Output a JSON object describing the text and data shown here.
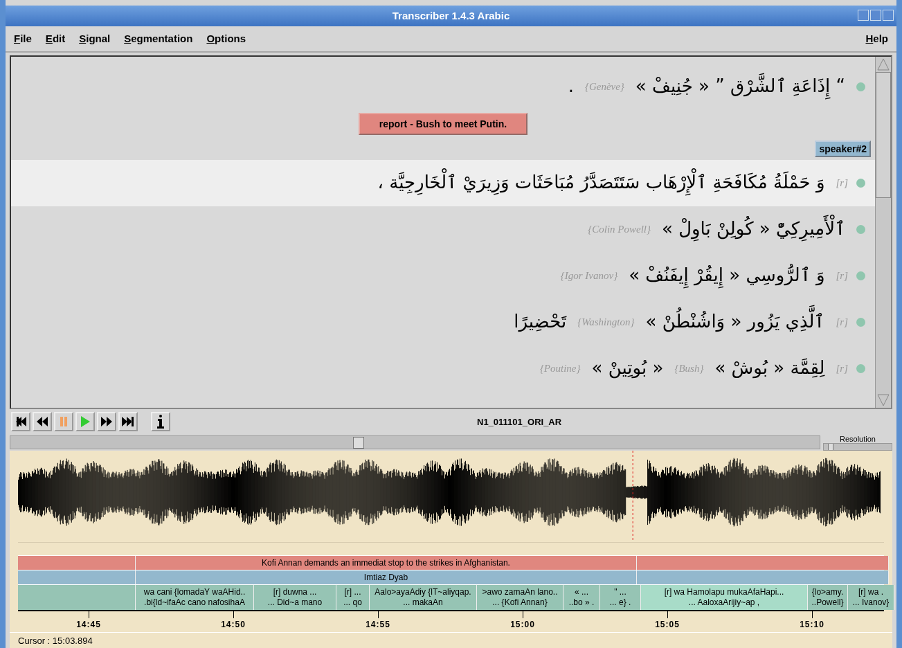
{
  "window": {
    "title": "Transcriber 1.4.3 Arabic"
  },
  "menu": [
    {
      "label": "File"
    },
    {
      "label": "Edit"
    },
    {
      "label": "Signal"
    },
    {
      "label": "Segmentation"
    },
    {
      "label": "Options"
    }
  ],
  "help_menu": "Help",
  "transcript": [
    {
      "kind": "line",
      "selected": false,
      "parts": [
        {
          "kind": "ar",
          "text": "."
        },
        {
          "kind": "note",
          "text": "{Genève}"
        },
        {
          "kind": "ar",
          "text": "“ إِذَاعَةِ ٱلشَّرْق ” « جُنِيفْ »"
        }
      ]
    },
    {
      "kind": "section",
      "text": "report - Bush to meet Putin."
    },
    {
      "kind": "speaker",
      "text": "speaker#2"
    },
    {
      "kind": "line",
      "selected": true,
      "parts": [
        {
          "kind": "ar",
          "text": "وَ حَمْلَةُ مُكَافَحَةِ ٱلْإِرْهَاب سَتَتَصَدَّرُ مُبَاحَثَات وَزِيرَيْ ٱلْخَارِجِيَّة ،"
        },
        {
          "kind": "note",
          "text": "[r]"
        }
      ]
    },
    {
      "kind": "line",
      "selected": false,
      "parts": [
        {
          "kind": "note",
          "text": "{Colin Powell}"
        },
        {
          "kind": "ar",
          "text": "ٱلْأَمِيرِكِيّْ « كُولِنْ بَاوِلْ »"
        }
      ]
    },
    {
      "kind": "line",
      "selected": false,
      "parts": [
        {
          "kind": "note",
          "text": "{Igor Ivanov}"
        },
        {
          "kind": "ar",
          "text": "وَ ٱلرُّوسِي « إِيقُرْ إِيفَنُفْ »"
        },
        {
          "kind": "note",
          "text": "[r]"
        }
      ]
    },
    {
      "kind": "line",
      "selected": false,
      "parts": [
        {
          "kind": "ar",
          "text": "تَحْضِيرًا"
        },
        {
          "kind": "note",
          "text": "{Washington}"
        },
        {
          "kind": "ar",
          "text": "ٱلَّذِي يَزُور « وَاشُنْطُنْ »"
        },
        {
          "kind": "note",
          "text": "[r]"
        }
      ]
    },
    {
      "kind": "line",
      "selected": false,
      "parts": [
        {
          "kind": "note",
          "text": "{Poutine}"
        },
        {
          "kind": "ar",
          "text": "« بُوتِينْ »"
        },
        {
          "kind": "note",
          "text": "{Bush}"
        },
        {
          "kind": "ar",
          "text": "لِقِمَّة « بُوشْ »"
        },
        {
          "kind": "note",
          "text": "[r]"
        }
      ]
    }
  ],
  "player": {
    "filename": "N1_011101_ORI_AR",
    "playing": false
  },
  "resolution": {
    "label": "Resolution",
    "level": 0.06
  },
  "tiers": [
    {
      "kind": "section",
      "segments": [
        {
          "kind": "blank"
        },
        {
          "kind": "labeled",
          "text": "Kofi Annan demands an immediat stop to the strikes in Afghanistan."
        },
        {
          "kind": "blank"
        }
      ]
    },
    {
      "kind": "speaker",
      "segments": [
        {
          "kind": "blank"
        },
        {
          "kind": "labeled",
          "text": "Imtiaz Dyab"
        },
        {
          "kind": "blank"
        }
      ]
    },
    {
      "kind": "turn",
      "segments": [
        {
          "kind": "blank"
        },
        {
          "kind": "labeled",
          "selected": false,
          "text": "wa cani {lomadaY waAHid..\n.bi{ld~ifaAc cano nafosihaA"
        },
        {
          "kind": "labeled",
          "selected": false,
          "text": "[r] duwna ...\n... Did~a mano"
        },
        {
          "kind": "labeled",
          "selected": false,
          "text": "[r] ...\n... qo"
        },
        {
          "kind": "labeled",
          "selected": false,
          "text": "Aalo>ayaAdiy {lT~aliyqap.\n... makaAn"
        },
        {
          "kind": "labeled",
          "selected": false,
          "text": ">awo zamaAn lano..\n... {Kofi Annan}"
        },
        {
          "kind": "labeled",
          "selected": false,
          "text": "« ...\n..bo » ."
        },
        {
          "kind": "labeled",
          "selected": false,
          "text": "\" ...\n... e} ."
        },
        {
          "kind": "labeled",
          "selected": true,
          "text": "[r] wa Hamolapu mukaAfaHapi...\n... AaloxaArijiy~ap ,"
        },
        {
          "kind": "labeled",
          "selected": false,
          "text": "{lo>amy.\n..Powell}"
        },
        {
          "kind": "labeled",
          "selected": false,
          "text": "[r] wa .\n... Ivanov}"
        }
      ]
    }
  ],
  "axis_ticks": [
    "14:45",
    "14:50",
    "14:55",
    "15:00",
    "15:05",
    "15:10"
  ],
  "status": "Cursor : 15:03.894"
}
